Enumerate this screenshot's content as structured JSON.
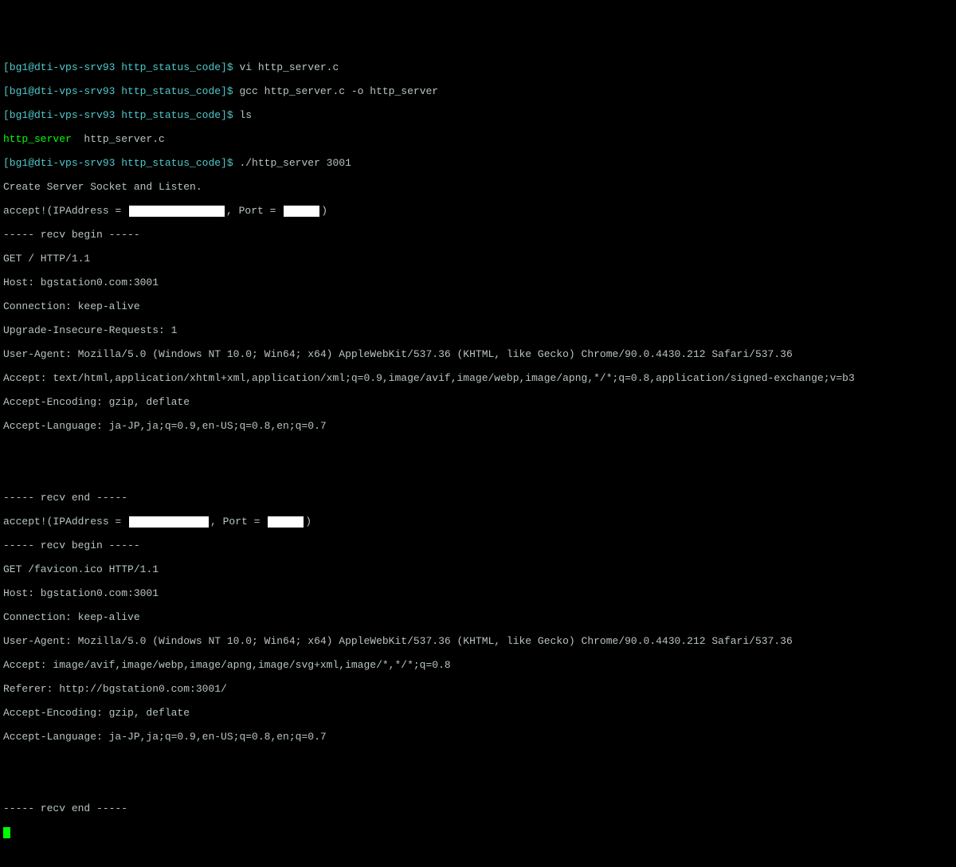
{
  "prompt_prefix": "[bg1@dti-vps-srv93 http_status_code]$ ",
  "cmd1": "vi http_server.c",
  "cmd2": "gcc http_server.c -o http_server",
  "cmd3": "ls",
  "ls_out1": "http_server",
  "ls_out2": "  http_server.c",
  "cmd4": "./http_server 3001",
  "l_create": "Create Server Socket and Listen.",
  "l_accept_pre": "accept!(IPAddress = ",
  "l_accept_mid": ", Port = ",
  "l_accept_post": ")",
  "l_recv_begin": "----- recv begin -----",
  "l_recv_end": "----- recv end -----",
  "req1": {
    "line1": "GET / HTTP/1.1",
    "line2": "Host: bgstation0.com:3001",
    "line3": "Connection: keep-alive",
    "line4": "Upgrade-Insecure-Requests: 1",
    "line5": "User-Agent: Mozilla/5.0 (Windows NT 10.0; Win64; x64) AppleWebKit/537.36 (KHTML, like Gecko) Chrome/90.0.4430.212 Safari/537.36",
    "line6": "Accept: text/html,application/xhtml+xml,application/xml;q=0.9,image/avif,image/webp,image/apng,*/*;q=0.8,application/signed-exchange;v=b3",
    "line7": "Accept-Encoding: gzip, deflate",
    "line8": "Accept-Language: ja-JP,ja;q=0.9,en-US;q=0.8,en;q=0.7"
  },
  "req2": {
    "line1": "GET /favicon.ico HTTP/1.1",
    "line2": "Host: bgstation0.com:3001",
    "line3": "Connection: keep-alive",
    "line4": "User-Agent: Mozilla/5.0 (Windows NT 10.0; Win64; x64) AppleWebKit/537.36 (KHTML, like Gecko) Chrome/90.0.4430.212 Safari/537.36",
    "line5": "Accept: image/avif,image/webp,image/apng,image/svg+xml,image/*,*/*;q=0.8",
    "line6": "Referer: http://bgstation0.com:3001/",
    "line7": "Accept-Encoding: gzip, deflate",
    "line8": "Accept-Language: ja-JP,ja;q=0.9,en-US;q=0.8,en;q=0.7"
  }
}
